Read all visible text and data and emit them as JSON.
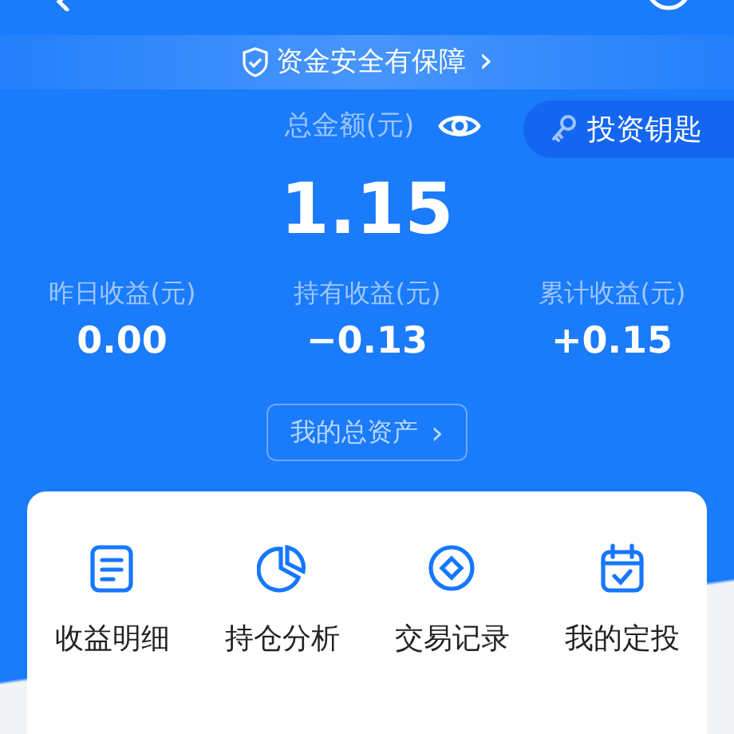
{
  "banner": {
    "text": "资金安全有保障",
    "arrow": "›"
  },
  "total": {
    "label": "总金额(元)",
    "value": "1.15",
    "visible": true
  },
  "key_button": {
    "label": "投资钥匙"
  },
  "stats": [
    {
      "label": "昨日收益(元)",
      "value": "0.00"
    },
    {
      "label": "持有收益(元)",
      "value": "−0.13"
    },
    {
      "label": "累计收益(元)",
      "value": "+0.15"
    }
  ],
  "assets_button": {
    "label": "我的总资产",
    "arrow": "›"
  },
  "menu": [
    {
      "kind": "document",
      "label": "收益明细"
    },
    {
      "kind": "pie",
      "label": "持仓分析"
    },
    {
      "kind": "coin",
      "label": "交易记录"
    },
    {
      "kind": "calendar",
      "label": "我的定投"
    }
  ]
}
